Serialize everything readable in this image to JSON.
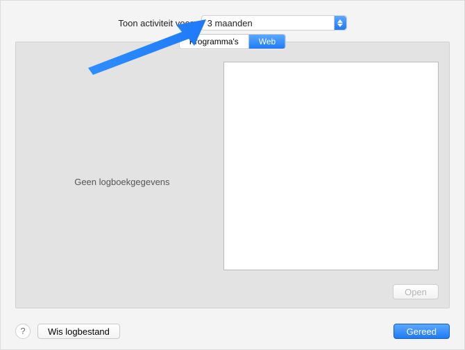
{
  "header": {
    "label": "Toon activiteit voor:",
    "selected": "3 maanden"
  },
  "tabs": {
    "programs": "Programma's",
    "web": "Web"
  },
  "panel": {
    "empty_message": "Geen logboekgegevens",
    "open": "Open"
  },
  "footer": {
    "help": "?",
    "clear_log": "Wis logbestand",
    "done": "Gereed"
  },
  "colors": {
    "accent": "#1e7af7"
  }
}
